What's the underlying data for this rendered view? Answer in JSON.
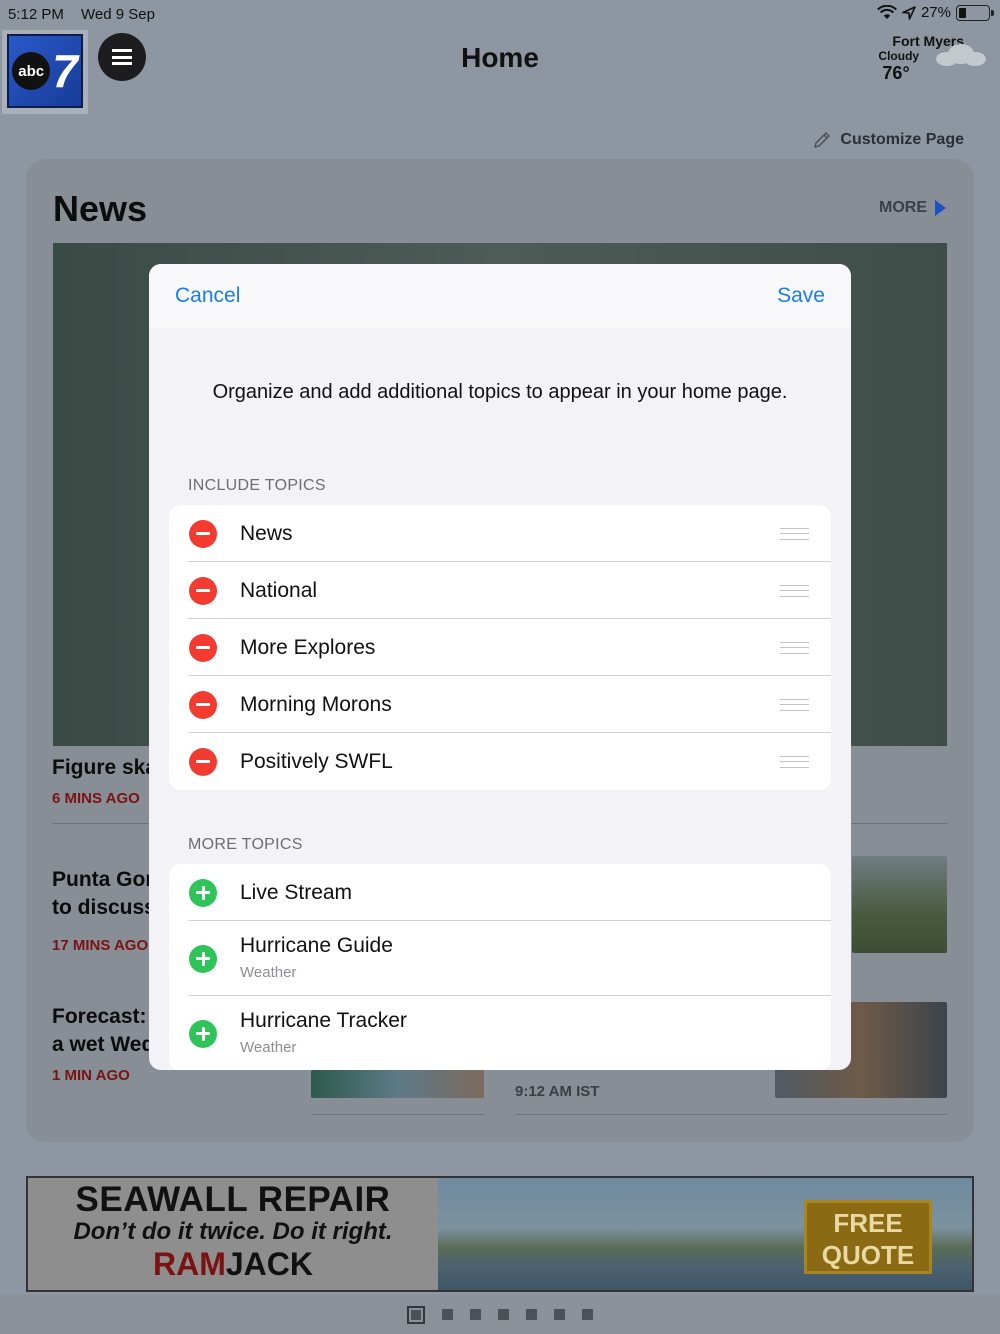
{
  "status_bar": {
    "time": "5:12 PM",
    "date": "Wed 9 Sep",
    "battery": "27%"
  },
  "header": {
    "logo_text": "abc",
    "logo_number": "7",
    "title": "Home",
    "weather": {
      "city": "Fort Myers",
      "condition": "Cloudy",
      "temperature": "76°"
    }
  },
  "customize_label": "Customize Page",
  "news": {
    "heading": "News",
    "more_label": "MORE",
    "stories": [
      {
        "title": "Figure ska",
        "ago": "6 MINS AGO"
      },
      {
        "title_line1": "Punta Gor",
        "title_line2": "to discuss",
        "ago": "17 MINS AGO"
      },
      {
        "title_line1": "Forecast: I",
        "title_line2": "a wet Wed",
        "ago": "1 MIN AGO"
      }
    ],
    "timestamp": "9:12 AM IST"
  },
  "ad": {
    "line1": "SEAWALL REPAIR",
    "line2": "Don’t do it twice. Do it right.",
    "brand_part1": "RAM",
    "brand_part2": "JACK",
    "cta_line1": "FREE",
    "cta_line2": "QUOTE"
  },
  "modal": {
    "cancel_label": "Cancel",
    "save_label": "Save",
    "intro": "Organize and add additional topics to appear in your home page.",
    "include_label": "INCLUDE TOPICS",
    "include_topics": [
      {
        "label": "News"
      },
      {
        "label": "National"
      },
      {
        "label": "More Explores"
      },
      {
        "label": "Morning Morons"
      },
      {
        "label": "Positively SWFL"
      }
    ],
    "more_label": "MORE TOPICS",
    "more_topics": [
      {
        "label": "Live Stream",
        "subtitle": ""
      },
      {
        "label": "Hurricane Guide",
        "subtitle": "Weather"
      },
      {
        "label": "Hurricane Tracker",
        "subtitle": "Weather"
      }
    ]
  },
  "pager": {
    "active_index": 0,
    "count": 7
  },
  "colors": {
    "accent": "#1a7cf2",
    "remove": "#f33b30",
    "add": "#2fc45a",
    "breaking": "#7a1414"
  }
}
